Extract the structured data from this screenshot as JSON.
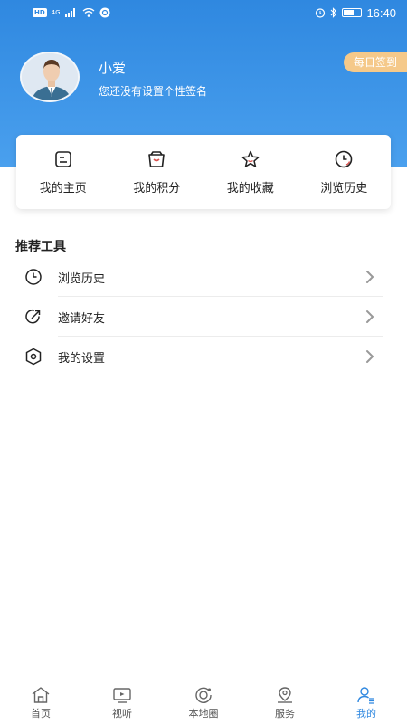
{
  "status_bar": {
    "left_badge": "HD",
    "network": "4G",
    "time": "16:40"
  },
  "profile": {
    "username": "小爱",
    "signature": "您还没有设置个性签名",
    "checkin_label": "每日签到"
  },
  "quick_actions": [
    {
      "label": "我的主页",
      "icon": "homepage-icon"
    },
    {
      "label": "我的积分",
      "icon": "points-bag-icon"
    },
    {
      "label": "我的收藏",
      "icon": "star-icon"
    },
    {
      "label": "浏览历史",
      "icon": "clock-icon"
    }
  ],
  "tools": {
    "title": "推荐工具",
    "items": [
      {
        "label": "浏览历史",
        "icon": "clock-icon"
      },
      {
        "label": "邀请好友",
        "icon": "share-icon"
      },
      {
        "label": "我的设置",
        "icon": "settings-hexagon-icon"
      }
    ]
  },
  "tab_bar": {
    "items": [
      {
        "label": "首页",
        "icon": "home-icon",
        "active": false
      },
      {
        "label": "视听",
        "icon": "tv-icon",
        "active": false
      },
      {
        "label": "本地圈",
        "icon": "local-circle-icon",
        "active": false
      },
      {
        "label": "服务",
        "icon": "location-pin-icon",
        "active": false
      },
      {
        "label": "我的",
        "icon": "profile-icon",
        "active": true
      }
    ]
  },
  "colors": {
    "header_blue": "#2f88e0",
    "checkin_orange": "#f5c98a",
    "active_tab": "#2f88e0",
    "star_red": "#d9534f"
  }
}
